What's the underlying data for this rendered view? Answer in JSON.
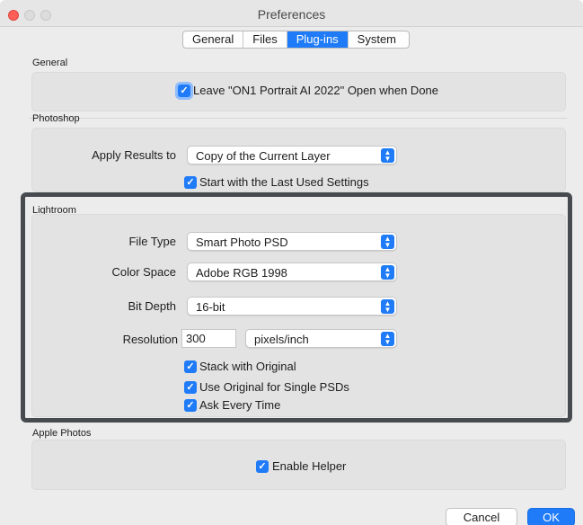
{
  "window": {
    "title": "Preferences"
  },
  "tabs": [
    {
      "label": "General",
      "active": false
    },
    {
      "label": "Files",
      "active": false
    },
    {
      "label": "Plug-ins",
      "active": true
    },
    {
      "label": "System",
      "active": false
    }
  ],
  "general": {
    "heading": "General",
    "leave_open": {
      "label": "Leave \"ON1 Portrait AI 2022\" Open when Done",
      "checked": true
    }
  },
  "photoshop": {
    "heading": "Photoshop",
    "apply_results": {
      "label": "Apply Results to",
      "value": "Copy of the Current Layer"
    },
    "last_used": {
      "label": "Start with the Last Used Settings",
      "checked": true
    }
  },
  "lightroom": {
    "heading": "Lightroom",
    "file_type": {
      "label": "File Type",
      "value": "Smart Photo PSD"
    },
    "color_space": {
      "label": "Color Space",
      "value": "Adobe RGB 1998"
    },
    "bit_depth": {
      "label": "Bit Depth",
      "value": "16-bit"
    },
    "resolution": {
      "label": "Resolution",
      "value": "300",
      "unit": "pixels/inch"
    },
    "stack_original": {
      "label": "Stack with Original",
      "checked": true
    },
    "use_original": {
      "label": "Use Original for Single PSDs",
      "checked": true
    },
    "ask_every_time": {
      "label": "Ask Every Time",
      "checked": true
    }
  },
  "apple_photos": {
    "heading": "Apple Photos",
    "enable_helper": {
      "label": "Enable Helper",
      "checked": true
    }
  },
  "footer": {
    "cancel_label": "Cancel",
    "ok_label": "OK"
  },
  "icons": {
    "checkmark": "✓",
    "popup_arrows": "⌃⌄"
  },
  "colors": {
    "accent": "#1f7bf7",
    "highlight_border": "#474b4f"
  }
}
